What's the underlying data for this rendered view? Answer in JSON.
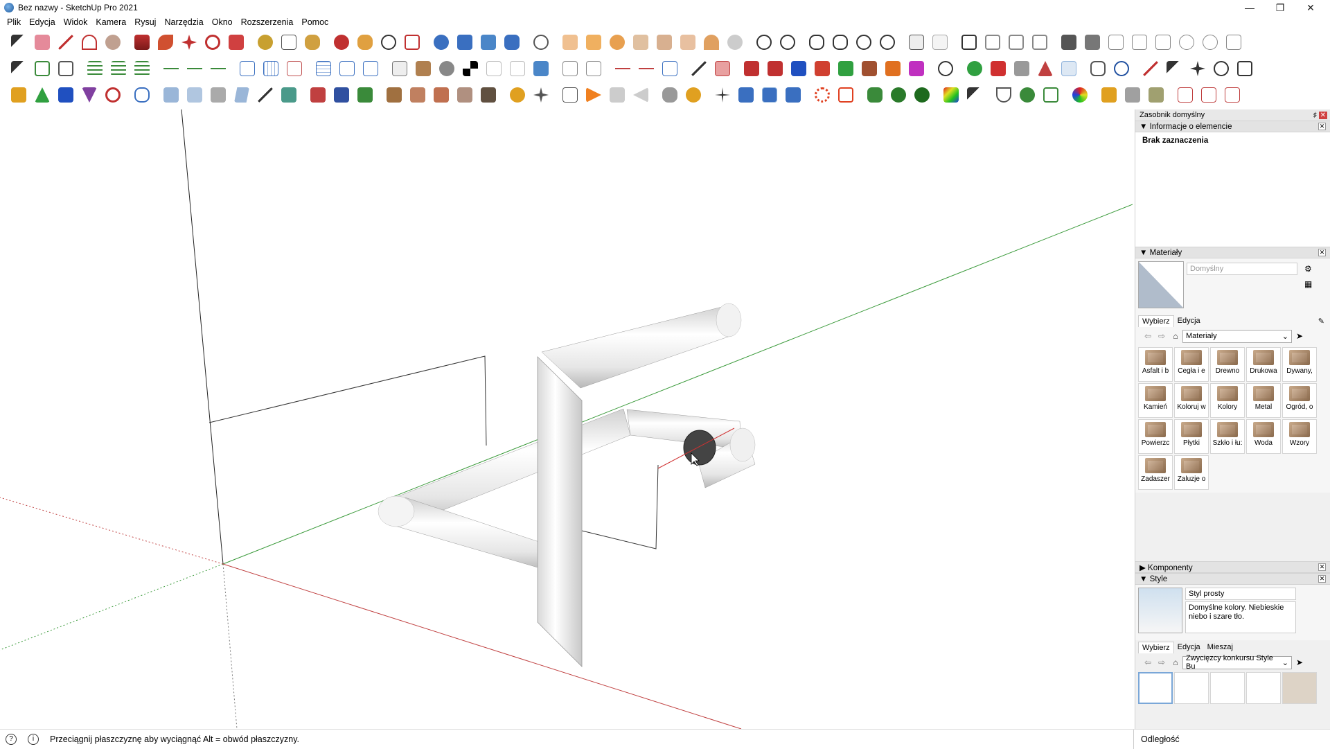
{
  "window": {
    "title": "Bez nazwy - SketchUp Pro 2021"
  },
  "menu": [
    "Plik",
    "Edycja",
    "Widok",
    "Kamera",
    "Rysuj",
    "Narzędzia",
    "Okno",
    "Rozszerzenia",
    "Pomoc"
  ],
  "tray": {
    "title": "Zasobnik domyślny",
    "entity_info": {
      "title": "Informacje o elemencie",
      "selection": "Brak zaznaczenia"
    },
    "materials": {
      "title": "Materiały",
      "current_name": "Domyślny",
      "tabs": [
        "Wybierz",
        "Edycja"
      ],
      "library": "Materiały",
      "items": [
        "Asfalt i b",
        "Cegła i e",
        "Drewno",
        "Drukowa",
        "Dywany,",
        "Kamień",
        "Koloruj w",
        "Kolory",
        "Metal",
        "Ogród, o",
        "Powierzc",
        "Płytki",
        "Szkło i łu:",
        "Woda",
        "Wzory",
        "Zadaszer",
        "Żaluzje o"
      ]
    },
    "components": {
      "title": "Komponenty"
    },
    "styles": {
      "title": "Style",
      "name": "Styl prosty",
      "description": "Domyślne kolory. Niebieskie niebo i szare tło.",
      "tabs": [
        "Wybierz",
        "Edycja",
        "Mieszaj"
      ],
      "library": "Zwycięzcy konkursu Style Bu"
    }
  },
  "status": {
    "hint": "Przeciągnij płaszczyznę aby wyciągnąć Alt = obwód płaszczyzny.",
    "measurement_label": "Odległość"
  },
  "colors": {
    "red_axis": "#c04040",
    "green_axis": "#3a9a3a",
    "blue_axis": "#3050c0",
    "pipe": "#e8e8e8"
  }
}
